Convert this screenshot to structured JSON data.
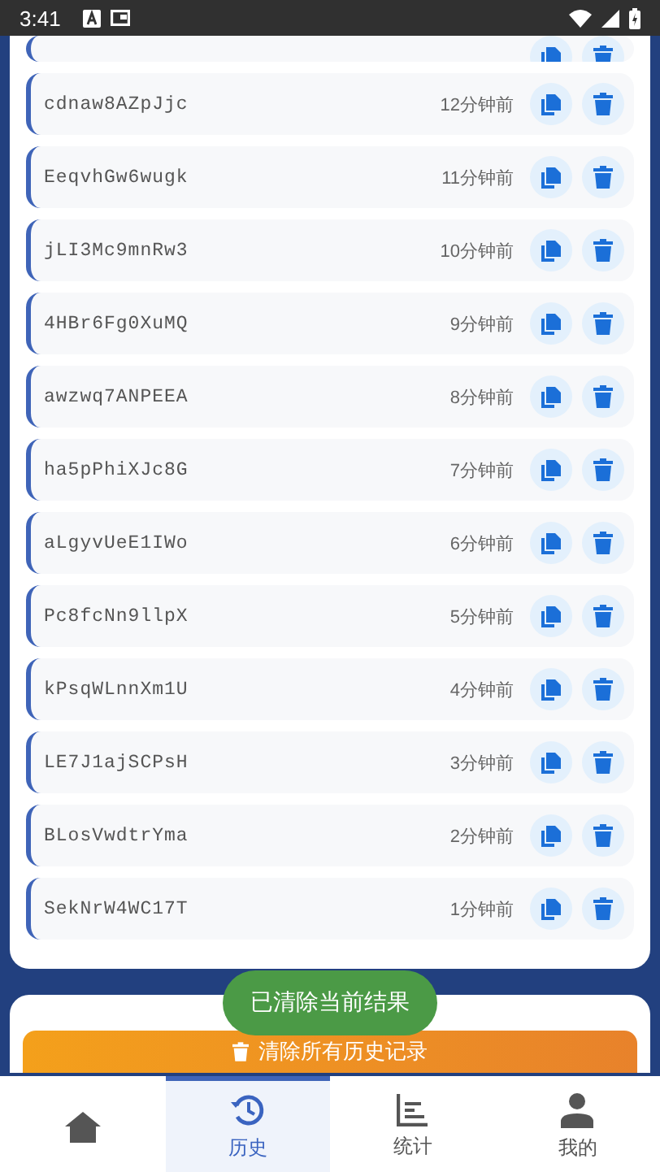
{
  "status_bar": {
    "time": "3:41"
  },
  "history": [
    {
      "cut_off": true
    },
    {
      "code": "cdnaw8AZpJjc",
      "time": "12分钟前"
    },
    {
      "code": "EeqvhGw6wugk",
      "time": "11分钟前"
    },
    {
      "code": "jLI3Mc9mnRw3",
      "time": "10分钟前"
    },
    {
      "code": "4HBr6Fg0XuMQ",
      "time": "9分钟前"
    },
    {
      "code": "awzwq7ANPEEA",
      "time": "8分钟前"
    },
    {
      "code": "ha5pPhiXJc8G",
      "time": "7分钟前"
    },
    {
      "code": "aLgyvUeE1IWo",
      "time": "6分钟前"
    },
    {
      "code": "Pc8fcNn9llpX",
      "time": "5分钟前"
    },
    {
      "code": "kPsqWLnnXm1U",
      "time": "4分钟前"
    },
    {
      "code": "LE7J1ajSCPsH",
      "time": "3分钟前"
    },
    {
      "code": "BLosVwdtrYma",
      "time": "2分钟前"
    },
    {
      "code": "SekNrW4WC17T",
      "time": "1分钟前"
    }
  ],
  "clear_all_button": {
    "label": "清除所有历史记录"
  },
  "toast": {
    "text": "已清除当前结果"
  },
  "bottom_nav": [
    {
      "kind": "home",
      "selected": false
    },
    {
      "kind": "history",
      "label": "历史",
      "selected": true
    },
    {
      "kind": "stats",
      "label": "统计",
      "selected": false
    },
    {
      "kind": "profile",
      "label": "我的",
      "selected": false
    }
  ]
}
